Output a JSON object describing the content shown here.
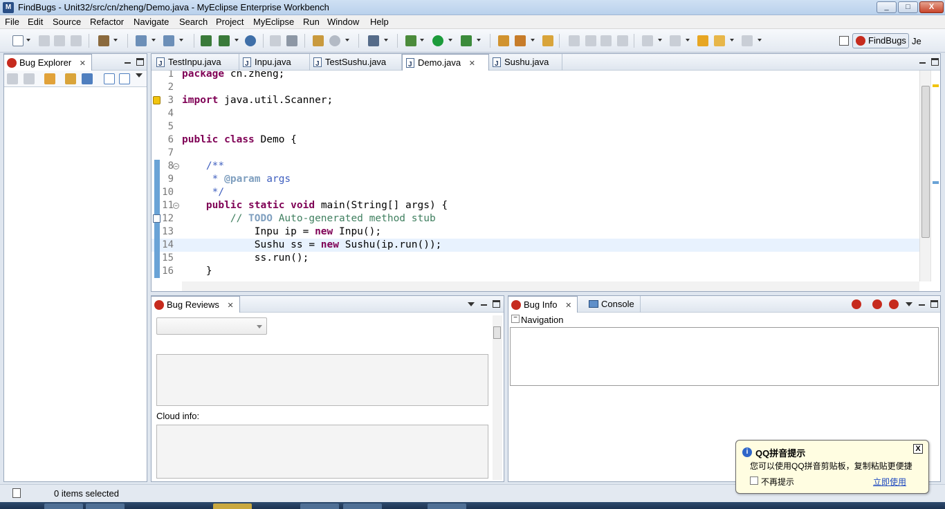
{
  "window": {
    "title": "FindBugs - Unit32/src/cn/zheng/Demo.java - MyEclipse Enterprise Workbench",
    "minimize": "_",
    "maximize": "□",
    "close": "X"
  },
  "menu": [
    "File",
    "Edit",
    "Source",
    "Refactor",
    "Navigate",
    "Search",
    "Project",
    "MyEclipse",
    "Run",
    "Window",
    "Help"
  ],
  "perspectives": {
    "active": "FindBugs",
    "other": "Je"
  },
  "bug_explorer": {
    "title": "Bug Explorer",
    "close": "✕"
  },
  "editor": {
    "tabs": [
      {
        "label": "TestInpu.java",
        "active": false
      },
      {
        "label": "Inpu.java",
        "active": false
      },
      {
        "label": "TestSushu.java",
        "active": false
      },
      {
        "label": "Demo.java",
        "active": true
      },
      {
        "label": "Sushu.java",
        "active": false
      }
    ],
    "close": "✕",
    "lines": [
      {
        "n": "1",
        "parts": [
          [
            "kw",
            "package"
          ],
          [
            "t",
            " cn.zheng;"
          ]
        ]
      },
      {
        "n": "2",
        "parts": []
      },
      {
        "n": "3",
        "parts": [
          [
            "kw",
            "import"
          ],
          [
            "t",
            " java.util.Scanner;"
          ]
        ],
        "marker": "warning"
      },
      {
        "n": "4",
        "parts": []
      },
      {
        "n": "5",
        "parts": []
      },
      {
        "n": "6",
        "parts": [
          [
            "kw",
            "public"
          ],
          [
            "t",
            " "
          ],
          [
            "kw",
            "class"
          ],
          [
            "t",
            " Demo {"
          ]
        ]
      },
      {
        "n": "7",
        "parts": []
      },
      {
        "n": "8",
        "parts": [
          [
            "t",
            "    "
          ],
          [
            "cm",
            "/**"
          ]
        ],
        "fold": true,
        "changed": true
      },
      {
        "n": "9",
        "parts": [
          [
            "t",
            "     "
          ],
          [
            "cm",
            "* "
          ],
          [
            "todo",
            "@param"
          ],
          [
            "cm",
            " args"
          ]
        ],
        "changed": true
      },
      {
        "n": "10",
        "parts": [
          [
            "t",
            "     "
          ],
          [
            "cm",
            "*/"
          ]
        ],
        "changed": true
      },
      {
        "n": "11",
        "parts": [
          [
            "t",
            "    "
          ],
          [
            "kw",
            "public"
          ],
          [
            "t",
            " "
          ],
          [
            "kw",
            "static"
          ],
          [
            "t",
            " "
          ],
          [
            "kw",
            "void"
          ],
          [
            "t",
            " main(String[] args) {"
          ]
        ],
        "fold": true,
        "changed": true
      },
      {
        "n": "12",
        "parts": [
          [
            "t",
            "        "
          ],
          [
            "cml",
            "// "
          ],
          [
            "todo",
            "TODO"
          ],
          [
            "cml",
            " Auto-generated method stub"
          ]
        ],
        "marker": "task",
        "changed": true
      },
      {
        "n": "13",
        "parts": [
          [
            "t",
            "            Inpu ip = "
          ],
          [
            "kw",
            "new"
          ],
          [
            "t",
            " Inpu();"
          ]
        ],
        "changed": true
      },
      {
        "n": "14",
        "parts": [
          [
            "t",
            "            Sushu ss = "
          ],
          [
            "kw",
            "new"
          ],
          [
            "t",
            " Sushu(ip.run());"
          ]
        ],
        "current": true,
        "changed": true
      },
      {
        "n": "15",
        "parts": [
          [
            "t",
            "            ss.run();"
          ]
        ],
        "changed": true
      },
      {
        "n": "16",
        "parts": [
          [
            "t",
            "    }"
          ]
        ],
        "changed": true
      }
    ]
  },
  "bug_reviews": {
    "title": "Bug Reviews",
    "close": "✕",
    "cloud_label": "Cloud info:"
  },
  "bug_info": {
    "tabs": [
      {
        "label": "Bug Info",
        "active": true
      },
      {
        "label": "Console",
        "active": false
      }
    ],
    "close": "✕",
    "navigation_label": "Navigation"
  },
  "status": {
    "text": "0 items selected"
  },
  "popup": {
    "title": "QQ拼音提示",
    "message": "您可以使用QQ拼音剪贴板，复制粘贴更便捷",
    "checkbox_label": "不再提示",
    "link": "立即使用",
    "close": "X",
    "info_icon": "i"
  },
  "colors": {
    "keyword": "#7f0055",
    "javadoc": "#3f5fbf",
    "comment": "#3f7f5f",
    "current_line": "#e8f2fe",
    "bug_icon": "#c62b1e"
  }
}
